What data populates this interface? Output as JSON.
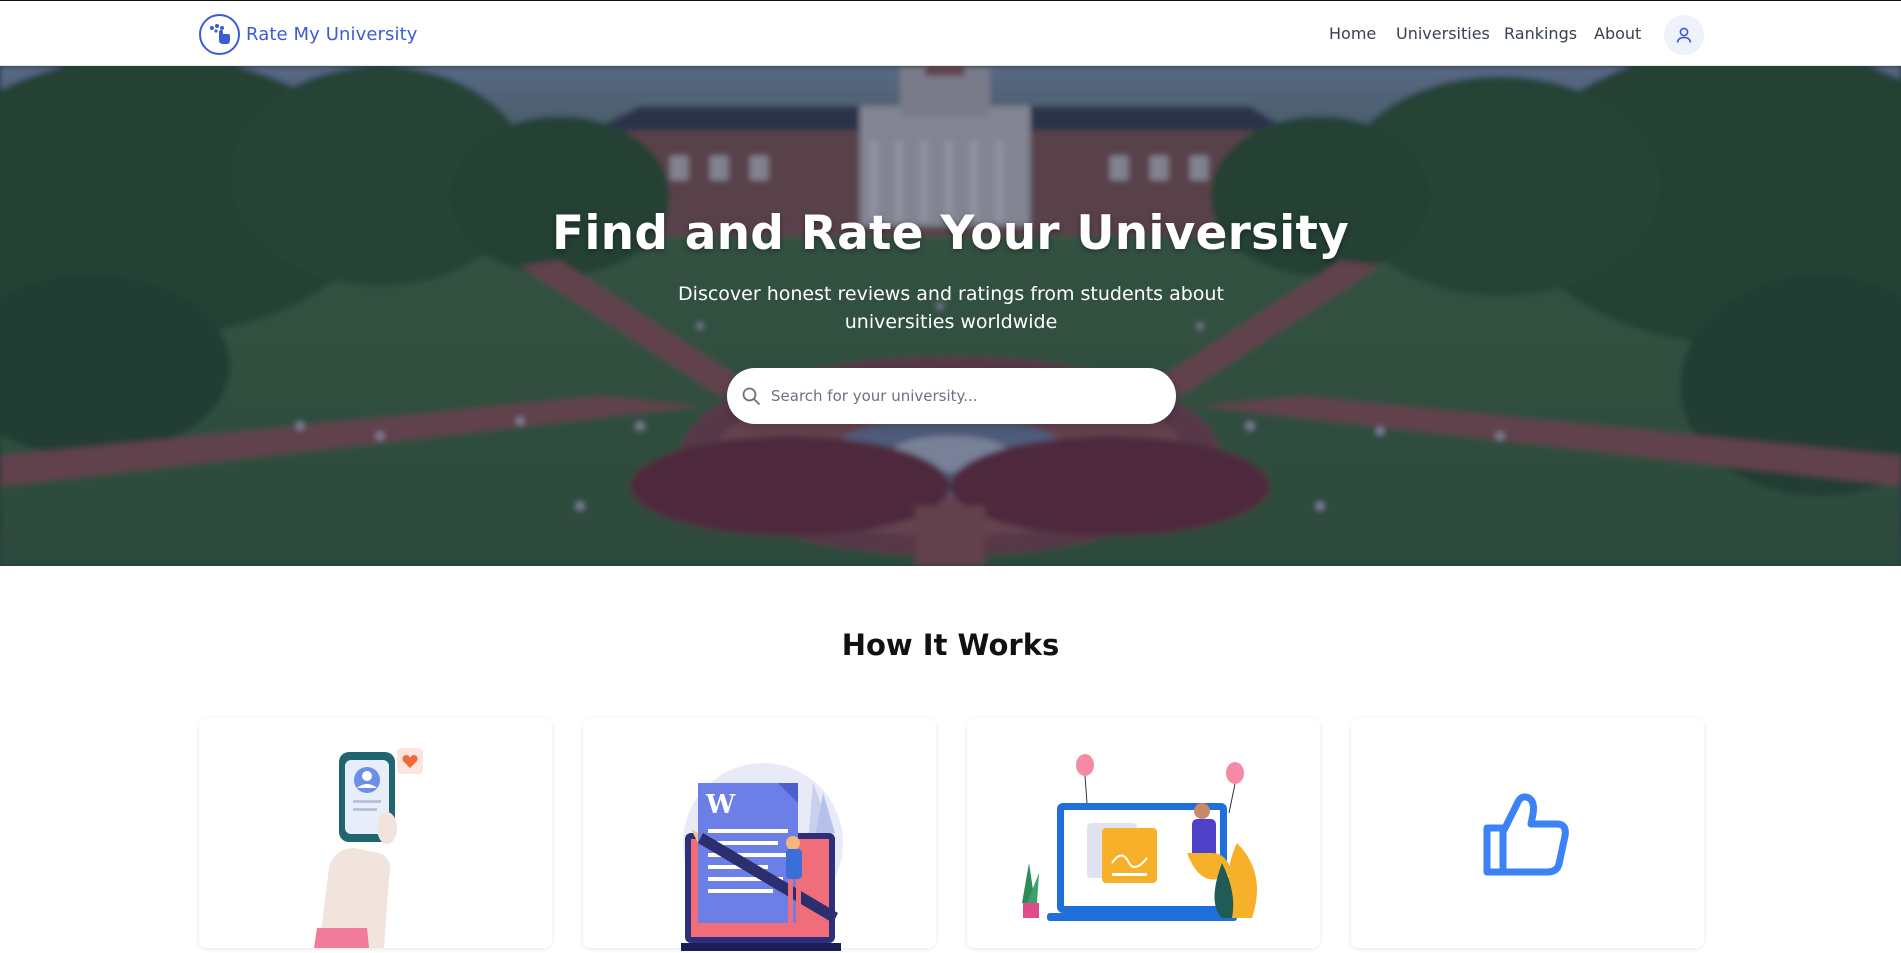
{
  "header": {
    "brand_name": "Rate My University",
    "nav": [
      "Home",
      "Universities",
      "Rankings",
      "About"
    ]
  },
  "hero": {
    "title": "Find and Rate Your University",
    "subtitle": "Discover honest reviews and ratings from students about universities worldwide",
    "search_placeholder": "Search for your university..."
  },
  "how_it_works": {
    "title": "How It Works",
    "cards": [
      {
        "icon": "phone-profile-like-icon"
      },
      {
        "icon": "document-writing-icon"
      },
      {
        "icon": "laptop-presentation-icon"
      },
      {
        "icon": "thumbs-up-icon"
      }
    ]
  },
  "colors": {
    "brand": "#3b5bd9",
    "nav_text": "#374151",
    "hero_overlay": "#19234b",
    "thumbs_up": "#3b82f6"
  }
}
